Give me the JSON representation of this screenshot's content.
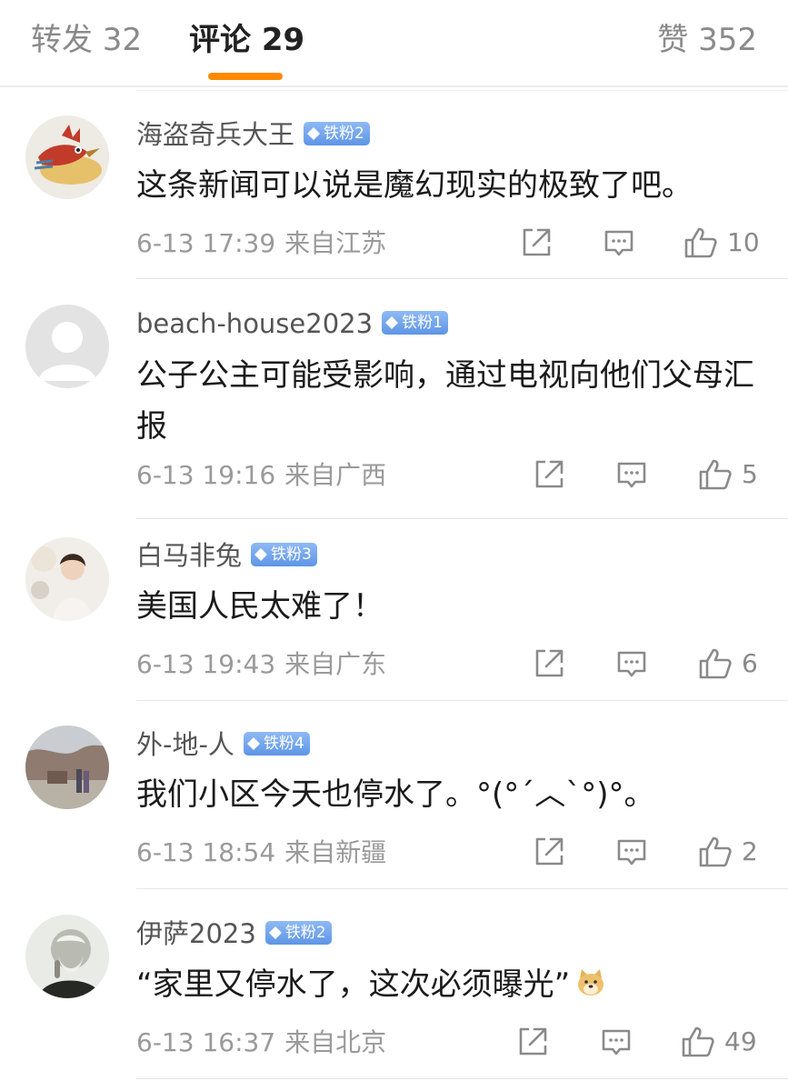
{
  "tabs": {
    "repost": "转发 32",
    "comments": "评论 29",
    "likes": "赞 352"
  },
  "colors": {
    "accent": "#ff8a00",
    "badge": "#6aa0ea"
  },
  "comments": [
    {
      "username": "海盗奇兵大王",
      "badge": "铁粉2",
      "text": "这条新闻可以说是魔幻现实的极致了吧。",
      "time": "6-13 17:39",
      "location": "来自江苏",
      "likes": "10",
      "avatar_icon": "red-bird-drawing-avatar"
    },
    {
      "username": "beach-house2023",
      "badge": "铁粉1",
      "text": "公子公主可能受影响，通过电视向他们父母汇报",
      "time": "6-13 19:16",
      "location": "来自广西",
      "likes": "5",
      "avatar_icon": "default-user-avatar"
    },
    {
      "username": "白马非兔",
      "badge": "铁粉3",
      "text": "美国人民太难了！",
      "time": "6-13 19:43",
      "location": "来自广东",
      "likes": "6",
      "avatar_icon": "child-photo-avatar"
    },
    {
      "username": "外-地-人",
      "badge": "铁粉4",
      "text": "我们小区今天也停水了。°(°ˊ︿ˋ°)°。",
      "time": "6-13 18:54",
      "location": "来自新疆",
      "likes": "2",
      "avatar_icon": "outdoor-photo-avatar"
    },
    {
      "username": "伊萨2023",
      "badge": "铁粉2",
      "text": "“家里又停水了，这次必须曝光”",
      "time": "6-13 16:37",
      "location": "来自北京",
      "likes": "49",
      "avatar_icon": "portrait-photo-avatar",
      "emoji": "doge-emoji"
    }
  ]
}
